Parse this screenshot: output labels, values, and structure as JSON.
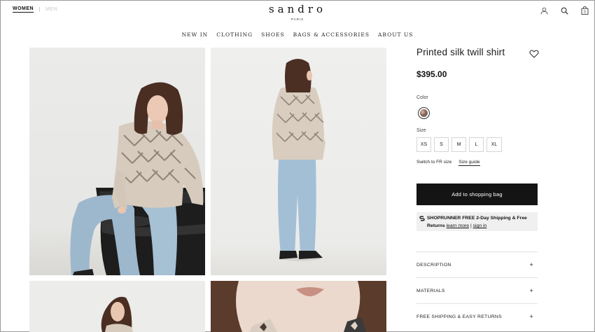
{
  "header": {
    "gender_women": "WOMEN",
    "gender_men": "MEN",
    "brand": "sandro",
    "brand_sub": "PARIS",
    "icons": [
      "account-icon",
      "search-icon",
      "bag-icon"
    ],
    "bag_count": "0"
  },
  "nav": {
    "items": [
      {
        "label": "NEW IN"
      },
      {
        "label": "CLOTHING"
      },
      {
        "label": "SHOES"
      },
      {
        "label": "BAGS & ACCESSORIES"
      },
      {
        "label": "ABOUT US"
      }
    ]
  },
  "product": {
    "title": "Printed silk twill shirt",
    "price": "$395.00",
    "color_label": "Color",
    "size_label": "Size",
    "sizes": [
      "XS",
      "S",
      "M",
      "L",
      "XL"
    ],
    "switch_size": "Switch to FR size",
    "size_guide": "Size guide",
    "add_to_bag": "Add to shopping bag",
    "shoprunner": {
      "line1": "SHOPRUNNER FREE 2-Day Shipping & Free",
      "returns": "Returns",
      "learn_more": "learn more",
      "divider": "|",
      "sign_in": "sign in"
    },
    "accordion": [
      {
        "label": "DESCRIPTION",
        "icon": "+"
      },
      {
        "label": "MATERIALS",
        "icon": "+"
      },
      {
        "label": "FREE SHIPPING & EASY RETURNS",
        "icon": "+"
      }
    ]
  },
  "colors": {
    "accent": "#141414",
    "panel_bg": "#f0f0f0",
    "border": "#d5d5d5"
  }
}
